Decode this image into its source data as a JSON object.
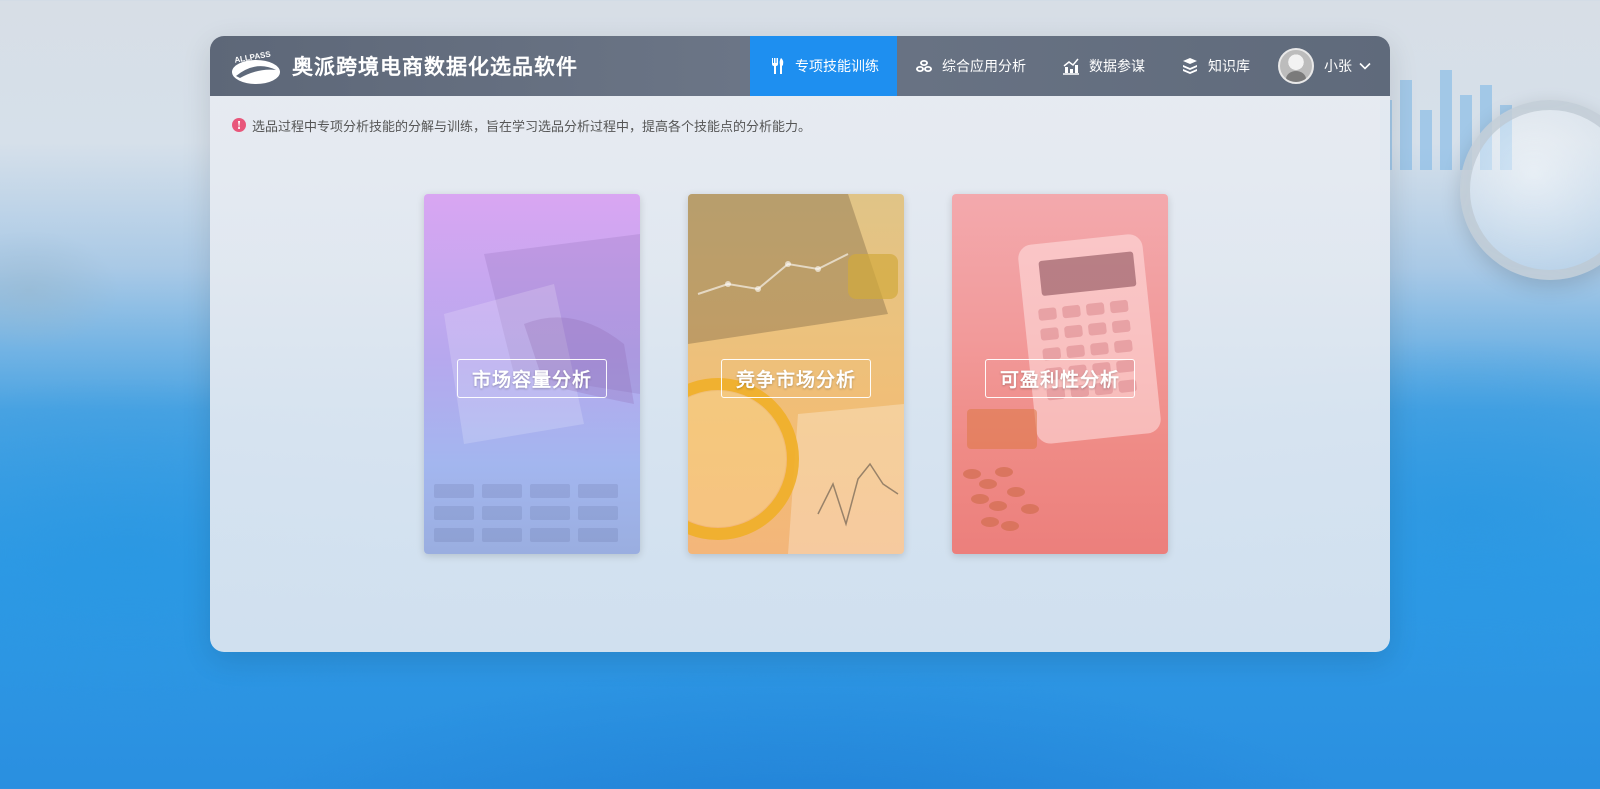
{
  "app": {
    "logo_text": "ALLPASS",
    "title": "奥派跨境电商数据化选品软件"
  },
  "nav": {
    "items": [
      {
        "label": "专项技能训练",
        "icon": "tools-icon",
        "active": true
      },
      {
        "label": "综合应用分析",
        "icon": "coins-icon",
        "active": false
      },
      {
        "label": "数据参谋",
        "icon": "chart-icon",
        "active": false
      },
      {
        "label": "知识库",
        "icon": "books-icon",
        "active": false
      }
    ],
    "user": {
      "name": "小张",
      "icon": "chevron-down-icon"
    }
  },
  "notice": {
    "icon": "info-icon",
    "text": "选品过程中专项分析技能的分解与训练，旨在学习选品分析过程中，提高各个技能点的分析能力。"
  },
  "cards": [
    {
      "label": "市场容量分析",
      "color": "#b7a8ee"
    },
    {
      "label": "竞争市场分析",
      "color": "#ebc27e"
    },
    {
      "label": "可盈利性分析",
      "color": "#f29a9a"
    }
  ],
  "colors": {
    "nav_active": "#1e8ff0",
    "header_bg": "#6b7586",
    "notice_icon": "#e8567a"
  }
}
